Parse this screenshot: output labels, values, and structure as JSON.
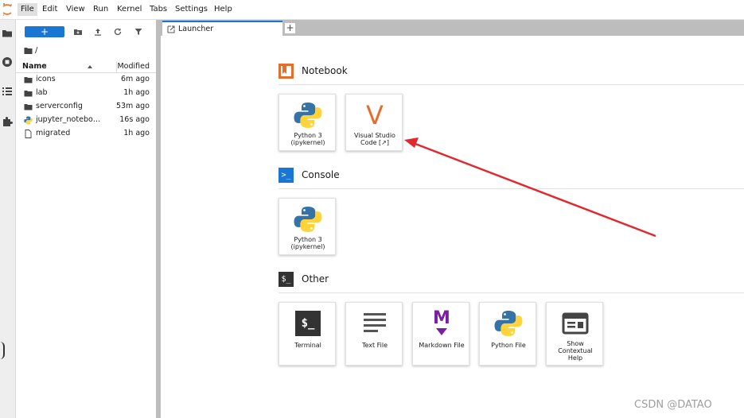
{
  "menubar": {
    "items": [
      "File",
      "Edit",
      "View",
      "Run",
      "Kernel",
      "Tabs",
      "Settings",
      "Help"
    ],
    "active": "File"
  },
  "filebrowser": {
    "new_label": "+",
    "breadcrumb": "/",
    "header_name": "Name",
    "header_modified": "Modified",
    "rows": [
      {
        "name": "icons",
        "modified": "6m ago",
        "icon": "folder-icon"
      },
      {
        "name": "lab",
        "modified": "1h ago",
        "icon": "folder-icon"
      },
      {
        "name": "serverconfig",
        "modified": "53m ago",
        "icon": "folder-icon"
      },
      {
        "name": "jupyter_noteboo...",
        "modified": "16s ago",
        "icon": "python-file-icon"
      },
      {
        "name": "migrated",
        "modified": "1h ago",
        "icon": "file-icon"
      }
    ]
  },
  "tabs": {
    "launcher_label": "Launcher",
    "add_label": "+"
  },
  "launcher": {
    "notebook_title": "Notebook",
    "console_title": "Console",
    "other_title": "Other",
    "notebook_cards": [
      {
        "label_line1": "Python 3",
        "label_line2": "(ipykernel)"
      },
      {
        "label_line1": "Visual Studio",
        "label_line2": "Code [↗]",
        "glyph": "V"
      }
    ],
    "console_cards": [
      {
        "label_line1": "Python 3",
        "label_line2": "(ipykernel)"
      }
    ],
    "other_cards": [
      {
        "label": "Terminal"
      },
      {
        "label": "Text File"
      },
      {
        "label": "Markdown File",
        "glyph": "M"
      },
      {
        "label": "Python File"
      },
      {
        "label_line1": "Show",
        "label_line2": "Contextual",
        "label_line3": "Help"
      }
    ]
  },
  "icons": {
    "terminal_glyph": "$_",
    "console_glyph": ">_",
    "other_glyph": "$_"
  },
  "colors": {
    "accent_blue": "#1976d2",
    "notebook_orange": "#e46e2e",
    "arrow_red": "#e0282e",
    "markdown_purple": "#7b1fa2"
  },
  "watermark": "CSDN @DATAO"
}
